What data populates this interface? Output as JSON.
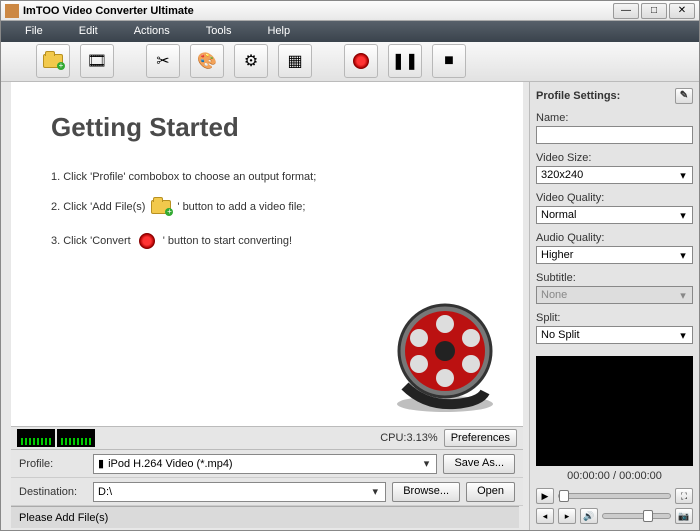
{
  "title": "ImTOO Video Converter Ultimate",
  "menu": {
    "file": "File",
    "edit": "Edit",
    "actions": "Actions",
    "tools": "Tools",
    "help": "Help"
  },
  "toolbar": {
    "addfile": "add-file",
    "addfolder": "film",
    "cut": "scissors",
    "palette": "palette",
    "gear": "gear",
    "watermark": "watermark",
    "record": "record",
    "pause": "pause",
    "stop": "stop"
  },
  "getting_started": {
    "heading": "Getting Started",
    "step1a": "1. Click 'Profile' combobox to choose an output format;",
    "step2a": "2. Click 'Add File(s)",
    "step2b": "' button to add a video file;",
    "step3a": "3. Click 'Convert",
    "step3b": "' button to start converting!"
  },
  "cpu": {
    "label": "CPU:3.13%",
    "preferences": "Preferences"
  },
  "profile": {
    "label": "Profile:",
    "value": "iPod H.264 Video (*.mp4)",
    "saveas": "Save As..."
  },
  "destination": {
    "label": "Destination:",
    "value": "D:\\",
    "browse": "Browse...",
    "open": "Open"
  },
  "status": "Please Add File(s)",
  "side": {
    "heading": "Profile Settings:",
    "name_label": "Name:",
    "name_value": "",
    "vsize_label": "Video Size:",
    "vsize_value": "320x240",
    "vqual_label": "Video Quality:",
    "vqual_value": "Normal",
    "aqual_label": "Audio Quality:",
    "aqual_value": "Higher",
    "sub_label": "Subtitle:",
    "sub_value": "None",
    "split_label": "Split:",
    "split_value": "No Split"
  },
  "player": {
    "time": "00:00:00 / 00:00:00"
  }
}
